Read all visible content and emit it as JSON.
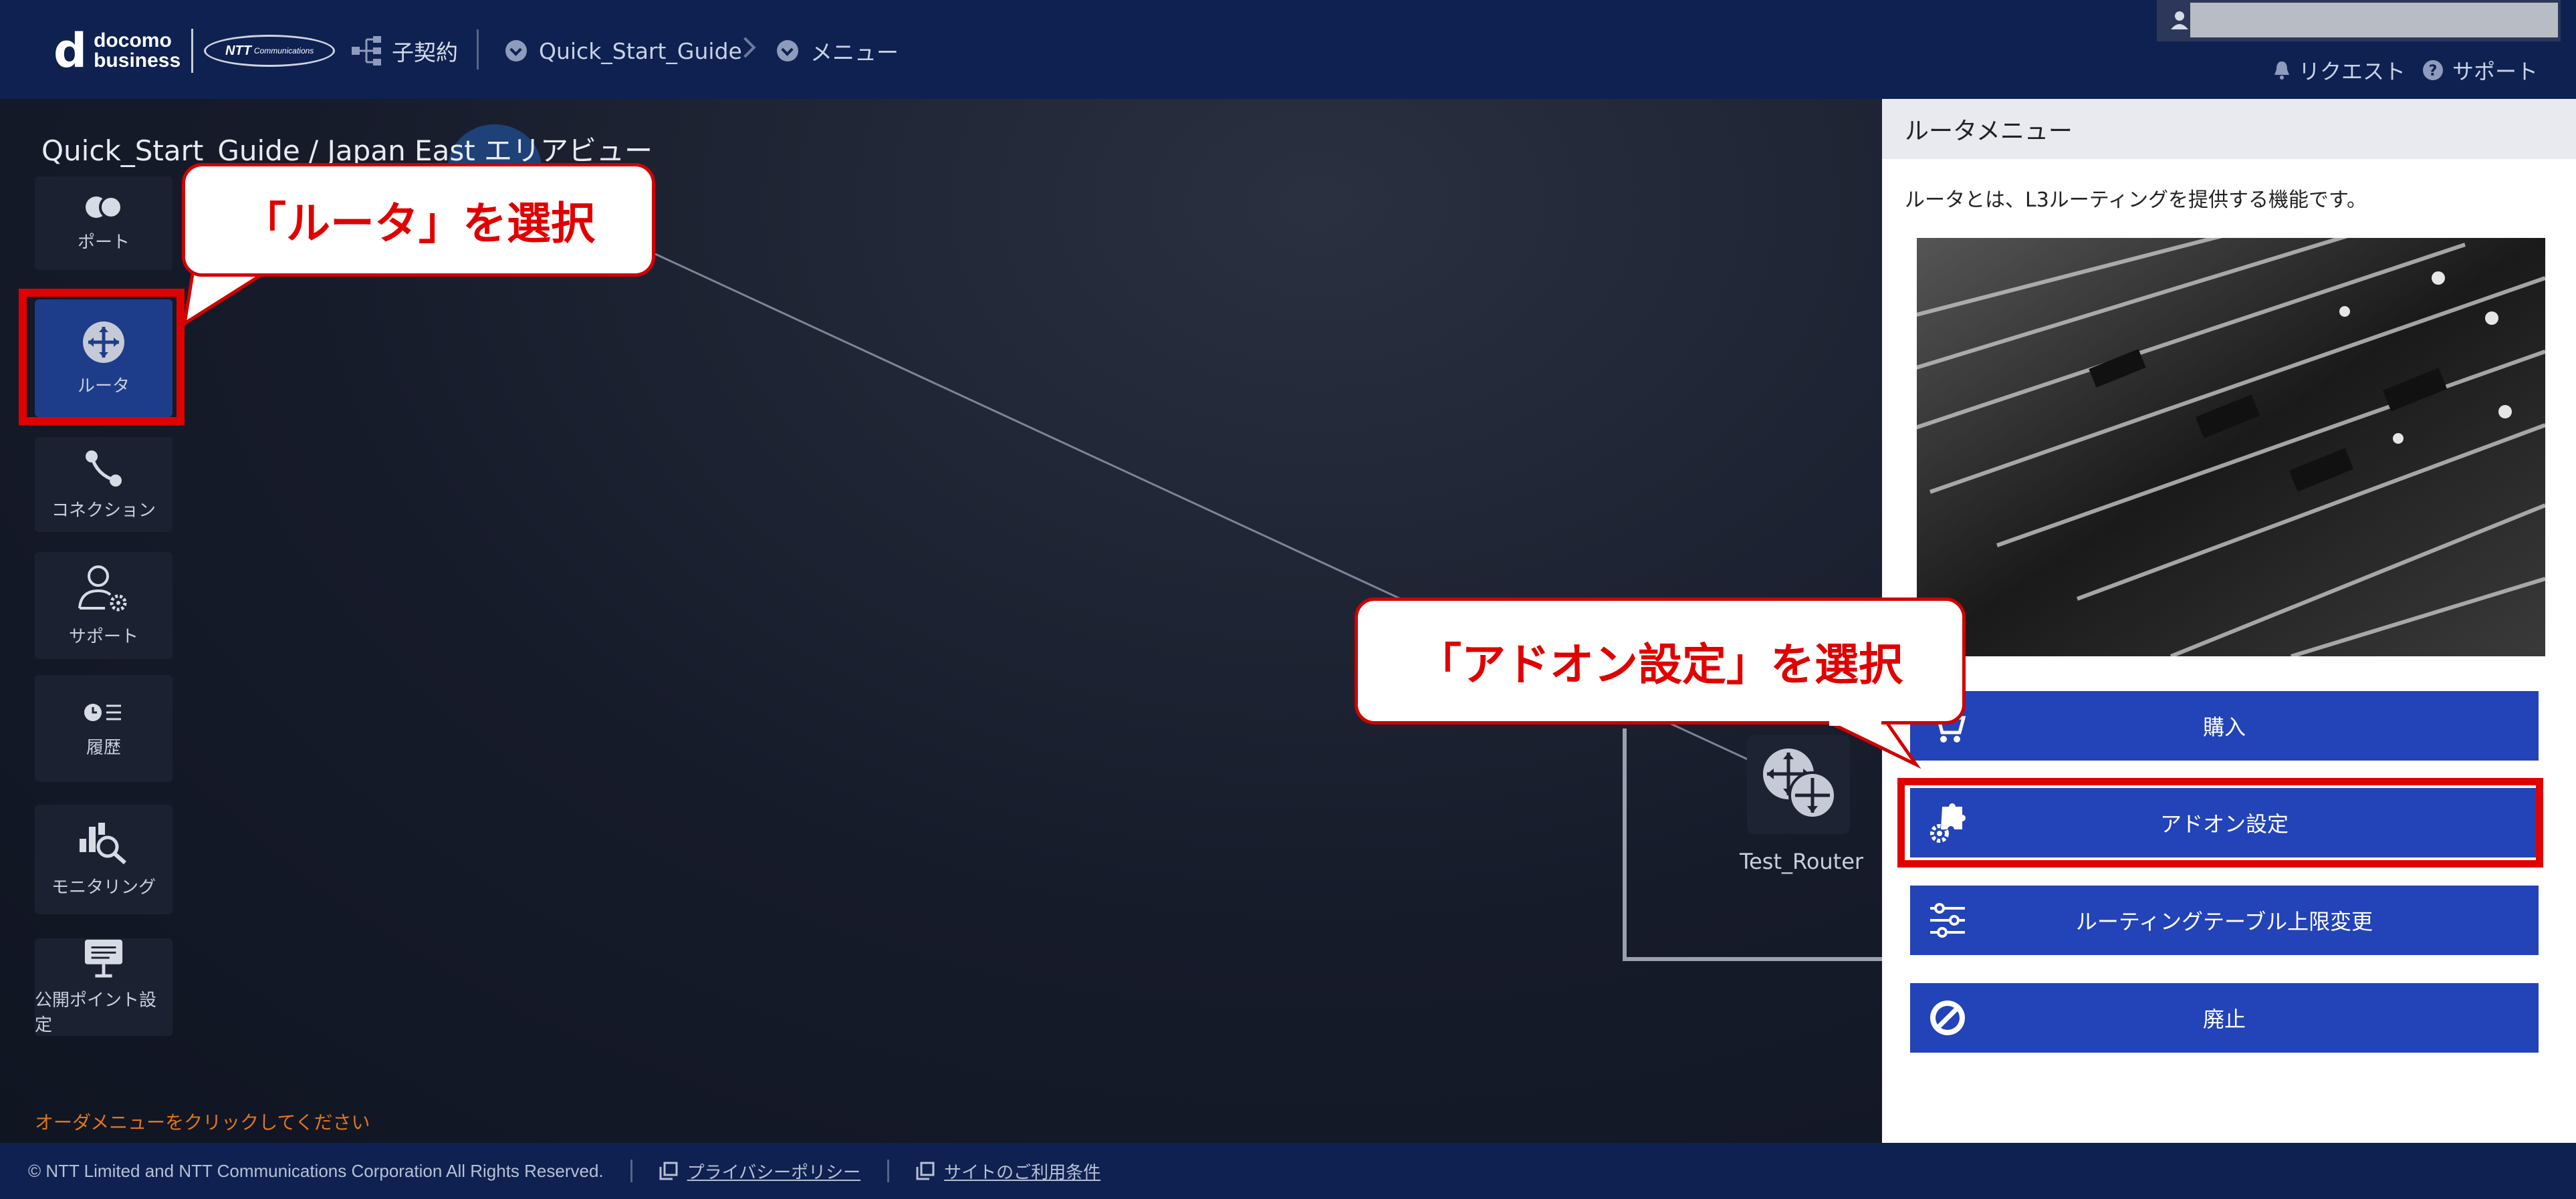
{
  "header": {
    "brand_d": "d",
    "brand_line1": "docomo",
    "brand_line2": "business",
    "ntt_logo": "NTT",
    "ntt_logo_sub": "Communications",
    "subcontract_label": "子契約",
    "breadcrumb_1": "Quick_Start_Guide",
    "breadcrumb_2": "メニュー",
    "request_label": "リクエスト",
    "support_label": "サポート"
  },
  "area": {
    "title": "Quick_Start_Guide / Japan East エリアビュー"
  },
  "sidebar": {
    "items": [
      {
        "label": "ポート",
        "icon": "port-icon"
      },
      {
        "label": "ルータ",
        "icon": "router-icon",
        "active": true
      },
      {
        "label": "コネクション",
        "icon": "connection-icon"
      },
      {
        "label": "サポート",
        "icon": "support-user-icon"
      },
      {
        "label": "履歴",
        "icon": "history-icon"
      },
      {
        "label": "モニタリング",
        "icon": "monitoring-icon"
      },
      {
        "label": "公開ポイント設定",
        "icon": "public-point-icon"
      }
    ]
  },
  "canvas": {
    "router_name": "Test_Router",
    "order_message": "オーダメニューをクリックしてください"
  },
  "annotations": {
    "callout_router": "「ルータ」を選択",
    "callout_addon": "「アドオン設定」を選択"
  },
  "panel": {
    "title": "ルータメニュー",
    "description": "ルータとは、L3ルーティングを提供する機能です。",
    "buttons": [
      {
        "label": "購入",
        "icon": "cart-icon"
      },
      {
        "label": "アドオン設定",
        "icon": "puzzle-gear-icon"
      },
      {
        "label": "ルーティングテーブル上限変更",
        "icon": "sliders-icon"
      },
      {
        "label": "廃止",
        "icon": "ban-icon"
      }
    ]
  },
  "footer": {
    "copyright": "© NTT Limited and NTT Communications Corporation All Rights Reserved.",
    "privacy_link": "プライバシーポリシー",
    "terms_link": "サイトのご利用条件"
  },
  "colors": {
    "header_bg": "#0e2150",
    "accent_blue": "#2343b8",
    "highlight_red": "#e10000",
    "order_msg": "#e0751b"
  }
}
